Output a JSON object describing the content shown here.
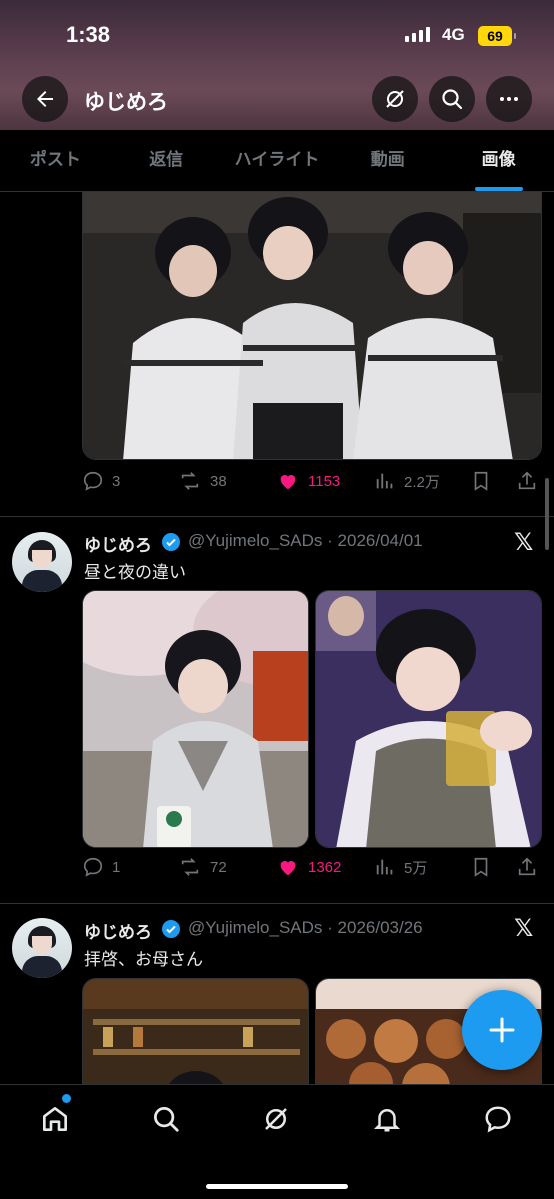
{
  "status_bar": {
    "time": "1:38",
    "network": "4G",
    "battery": "69"
  },
  "header": {
    "title": "ゆじめろ"
  },
  "tabs": [
    {
      "label": "ポスト"
    },
    {
      "label": "返信"
    },
    {
      "label": "ハイライト"
    },
    {
      "label": "動画"
    },
    {
      "label": "画像"
    }
  ],
  "active_tab": "画像",
  "posts": [
    {
      "counts": {
        "replies": "3",
        "reposts": "38",
        "likes": "1153",
        "views": "2.2万"
      }
    },
    {
      "name": "ゆじめろ",
      "handle_date": "@Yujimelo_SADs · 2026/04/01",
      "text": "昼と夜の違い",
      "counts": {
        "replies": "1",
        "reposts": "72",
        "likes": "1362",
        "views": "5万"
      }
    },
    {
      "name": "ゆじめろ",
      "handle_date": "@Yujimelo_SADs · 2026/03/26",
      "text": "拝啓、お母さん"
    }
  ],
  "colors": {
    "accent": "#1d9bf0",
    "like": "#f91880",
    "muted": "#71767b"
  }
}
